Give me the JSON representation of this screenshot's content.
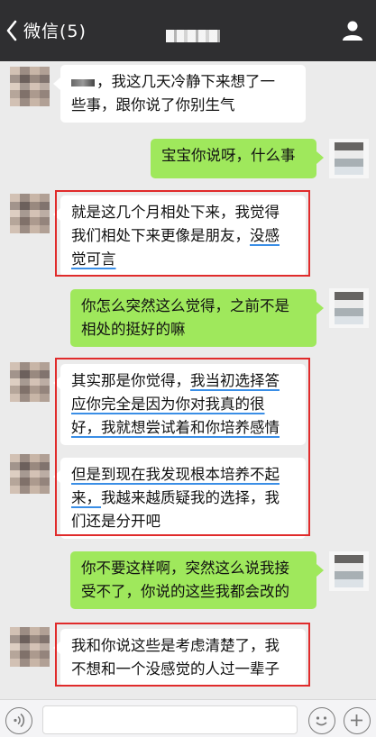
{
  "header": {
    "back_label": "微信(5)",
    "icons": {
      "back": "chevron-left-icon",
      "profile": "person-icon"
    }
  },
  "messages": [
    {
      "side": "left",
      "text_parts": [
        "，我这几天冷静下来想了一",
        "些事，跟你说了你别生气"
      ]
    },
    {
      "side": "right",
      "text": "宝宝你说呀，什么事"
    },
    {
      "side": "left",
      "line1": "就是这几个月相处下来，我觉得",
      "line2a": "我们相处下来更像是朋友，",
      "line2b": "没感",
      "line3": "觉可言"
    },
    {
      "side": "right",
      "line1": "你怎么突然这么觉得，之前不是",
      "line2": "相处的挺好的嘛"
    },
    {
      "side": "left",
      "line1a": "其实那是你觉得，",
      "line1b": "我当初选择答",
      "line2": "应你完全是因为你对我真的很",
      "line3": "好，我就想尝试着和你培养感情"
    },
    {
      "side": "left",
      "line1": "但是到现在我发现根本培养不起",
      "line2a": "来，",
      "line2b": "我越来越质疑我的选择，我",
      "line3": "们还是分开吧"
    },
    {
      "side": "right",
      "line1": "你不要这样啊，突然这么说我接",
      "line2": "受不了，你说的这些我都会改的"
    },
    {
      "side": "left",
      "line1": "我和你说这些是考虑清楚了，我",
      "line2": "不想和一个没感觉的人过一辈子"
    }
  ],
  "input_bar": {
    "icons": {
      "voice": "voice-icon",
      "emoji": "emoji-icon",
      "more": "plus-icon"
    }
  },
  "colors": {
    "header_bg": "#2f2f31",
    "chat_bg": "#ebebeb",
    "bubble_sent": "#9fe85c",
    "bubble_received": "#ffffff",
    "highlight_box": "#e02b2b",
    "underline": "#3a8ee6"
  }
}
